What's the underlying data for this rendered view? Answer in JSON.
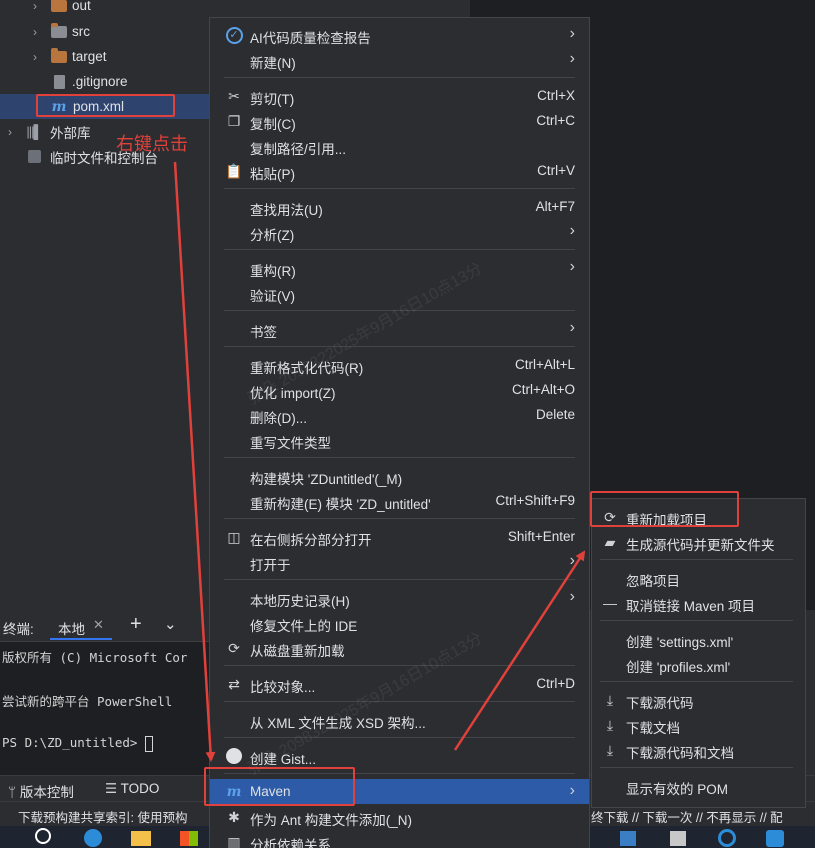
{
  "tree": {
    "items": [
      {
        "label": "out",
        "kind": "folder",
        "chevron": "›"
      },
      {
        "label": "src",
        "kind": "folder-plain",
        "chevron": "›"
      },
      {
        "label": "target",
        "kind": "folder",
        "chevron": "›"
      },
      {
        "label": ".gitignore",
        "kind": "file"
      },
      {
        "label": "pom.xml",
        "kind": "maven"
      },
      {
        "label": "外部库",
        "kind": "library",
        "chevron": "›"
      },
      {
        "label": "临时文件和控制台",
        "kind": "scratch"
      }
    ],
    "annotation": "右键点击"
  },
  "terminal": {
    "title": "终端:",
    "tab": "本地",
    "lines": [
      "版权所有 (C) Microsoft Cor",
      "尝试新的跨平台 PowerShell",
      "PS D:\\ZD_untitled> "
    ]
  },
  "toolwindows": [
    "版本控制",
    "TODO"
  ],
  "status_text": "下载预构建共享索引: 使用预构",
  "status_text_right": "终下载 // 下载一次 // 不再显示 // 配",
  "menu": {
    "items": [
      {
        "label": "AI代码质量检查报告",
        "icon": "check-circle-icon",
        "submenu": true
      },
      {
        "label": "新建(N)",
        "submenu": true
      },
      {
        "sep": true
      },
      {
        "label": "剪切(T)",
        "icon": "scissors-icon",
        "shortcut": "Ctrl+X"
      },
      {
        "label": "复制(C)",
        "icon": "copy-icon",
        "shortcut": "Ctrl+C"
      },
      {
        "label": "复制路径/引用..."
      },
      {
        "label": "粘贴(P)",
        "icon": "paste-icon",
        "shortcut": "Ctrl+V"
      },
      {
        "sep": true
      },
      {
        "label": "查找用法(U)",
        "shortcut": "Alt+F7"
      },
      {
        "label": "分析(Z)",
        "submenu": true
      },
      {
        "sep": true
      },
      {
        "label": "重构(R)",
        "submenu": true
      },
      {
        "label": "验证(V)"
      },
      {
        "sep": true
      },
      {
        "label": "书签",
        "submenu": true
      },
      {
        "sep": true
      },
      {
        "label": "重新格式化代码(R)",
        "shortcut": "Ctrl+Alt+L"
      },
      {
        "label": "优化 import(Z)",
        "shortcut": "Ctrl+Alt+O"
      },
      {
        "label": "删除(D)...",
        "shortcut": "Delete"
      },
      {
        "label": "重写文件类型"
      },
      {
        "sep": true
      },
      {
        "label": "构建模块 'ZDuntitled'(_M)"
      },
      {
        "label": "重新构建(E) 模块 'ZD_untitled'",
        "shortcut": "Ctrl+Shift+F9"
      },
      {
        "sep": true
      },
      {
        "label": "在右侧拆分部分打开",
        "icon": "split-icon",
        "shortcut": "Shift+Enter"
      },
      {
        "label": "打开于",
        "submenu": true
      },
      {
        "sep": true
      },
      {
        "label": "本地历史记录(H)",
        "submenu": true
      },
      {
        "label": "修复文件上的 IDE"
      },
      {
        "label": "从磁盘重新加载",
        "icon": "reload-icon"
      },
      {
        "sep": true
      },
      {
        "label": "比较对象...",
        "icon": "compare-icon",
        "shortcut": "Ctrl+D"
      },
      {
        "sep": true
      },
      {
        "label": "从 XML 文件生成 XSD 架构..."
      },
      {
        "sep": true
      },
      {
        "label": "创建 Gist...",
        "icon": "github-icon"
      },
      {
        "sep": true
      },
      {
        "label": "Maven",
        "icon": "maven-icon",
        "submenu": true,
        "highlighted": true
      },
      {
        "label": "作为 Ant 构建文件添加(_N)",
        "icon": "ant-icon"
      },
      {
        "label": "分析依赖关系...",
        "icon": "chart-icon"
      }
    ]
  },
  "submenu": {
    "items": [
      {
        "label": "重新加载项目",
        "icon": "reload-icon"
      },
      {
        "label": "生成源代码并更新文件夹",
        "icon": "folder-gear-icon"
      },
      {
        "sep": true
      },
      {
        "label": "忽略项目"
      },
      {
        "label": "取消链接 Maven 项目",
        "icon": "minus-icon"
      },
      {
        "sep": true
      },
      {
        "label": "创建 'settings.xml'"
      },
      {
        "label": "创建 'profiles.xml'"
      },
      {
        "sep": true
      },
      {
        "label": "下载源代码",
        "icon": "download-icon"
      },
      {
        "label": "下载文档",
        "icon": "download-icon"
      },
      {
        "label": "下载源代码和文档",
        "icon": "download-icon"
      },
      {
        "sep": true
      },
      {
        "label": "显示有效的 POM"
      }
    ]
  },
  "colors": {
    "annotation": "#e0413a",
    "highlight": "#2e5ba7",
    "selection": "#2e436e"
  }
}
